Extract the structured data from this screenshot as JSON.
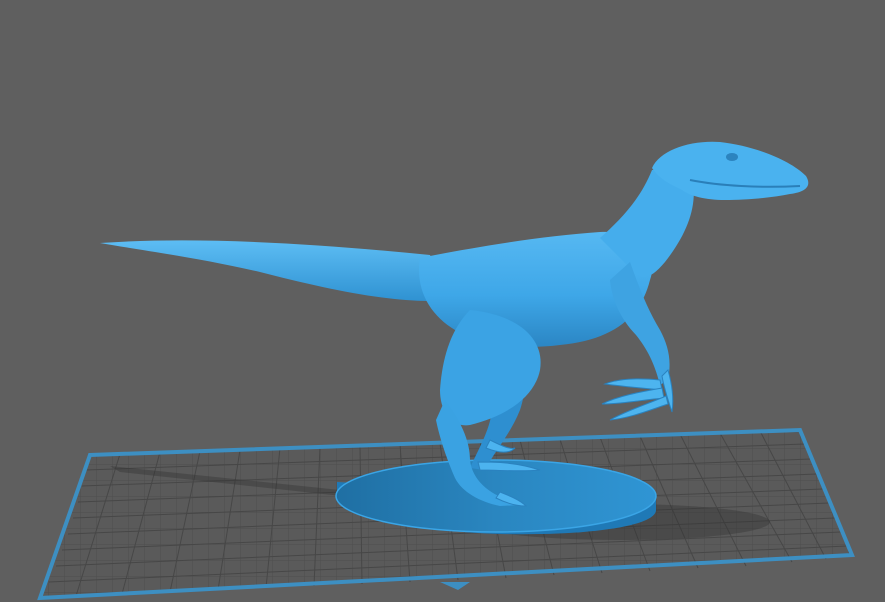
{
  "viewport": {
    "background_color": "#5f5f5f",
    "build_plate_color": "#3d8fc2",
    "grid_color": "#4a4a4a",
    "model_color": "#3ea7e8",
    "model_shadow_color": "#2b86c4",
    "base_color": "#2a8ccc",
    "model_name": "raptor-on-base"
  }
}
